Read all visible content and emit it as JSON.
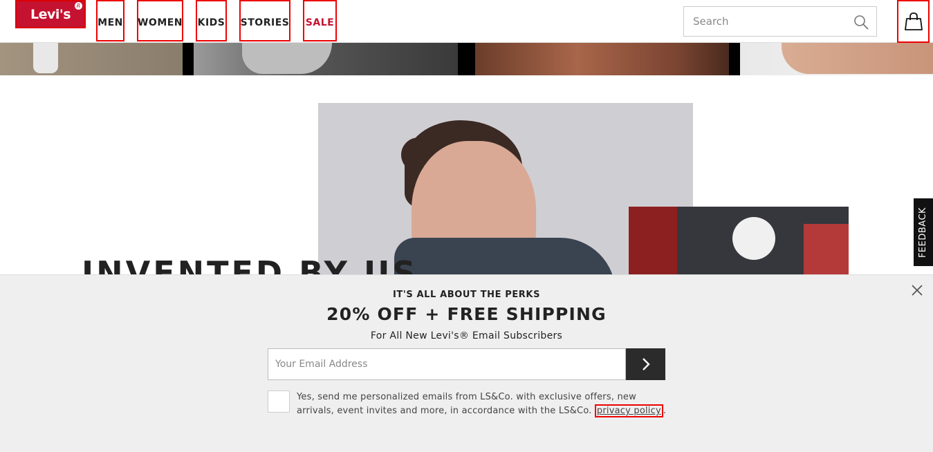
{
  "header": {
    "logo_text": "Levi's",
    "logo_reg": "R",
    "nav": [
      {
        "label": "MEN"
      },
      {
        "label": "WOMEN"
      },
      {
        "label": "KIDS"
      },
      {
        "label": "STORIES"
      },
      {
        "label": "SALE"
      }
    ],
    "search_placeholder": "Search"
  },
  "hero": {
    "headline": "INVENTED BY US"
  },
  "feedback_tab": "FEEDBACK",
  "email_signup": {
    "kicker": "IT'S ALL ABOUT THE PERKS",
    "offer": "20% OFF + FREE SHIPPING",
    "subline": "For All New Levi's® Email Subscribers",
    "email_placeholder": "Your Email Address",
    "consent_text": "Yes, send me personalized emails from LS&Co. with exclusive offers, new arrivals, event invites and more, in accordance with the LS&Co. ",
    "privacy_link": "privacy policy",
    "consent_end": "."
  },
  "colors": {
    "brand_red": "#c41230",
    "overlay_bg": "#efefef",
    "submit_bg": "#2b2b2b"
  }
}
